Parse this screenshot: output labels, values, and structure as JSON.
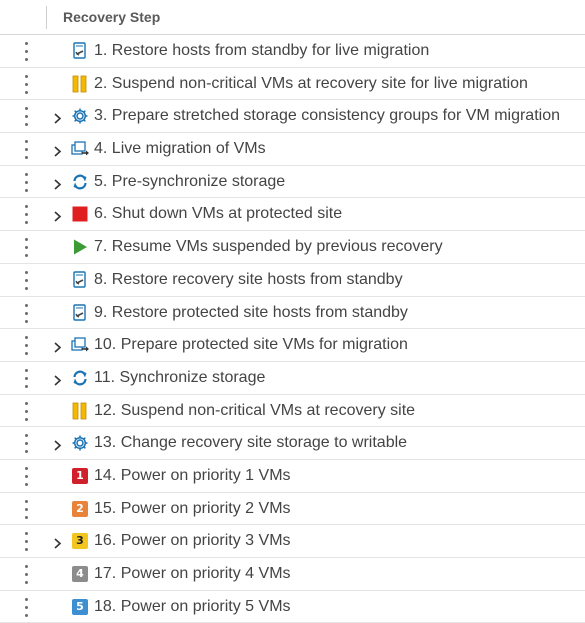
{
  "header": {
    "title": "Recovery Step"
  },
  "steps": [
    {
      "label": "1. Restore hosts from standby for live migration",
      "icon": "host-restore-icon",
      "expandable": false
    },
    {
      "label": "2. Suspend non-critical VMs at recovery site for live migration",
      "icon": "pause-icon",
      "expandable": false
    },
    {
      "label": "3. Prepare stretched storage consistency groups for VM migration",
      "icon": "gear-icon",
      "expandable": true
    },
    {
      "label": "4. Live migration of VMs",
      "icon": "vm-migrate-icon",
      "expandable": true
    },
    {
      "label": "5. Pre-synchronize storage",
      "icon": "sync-icon",
      "expandable": true
    },
    {
      "label": "6. Shut down VMs at protected site",
      "icon": "stop-icon",
      "expandable": true
    },
    {
      "label": "7. Resume VMs suspended by previous recovery",
      "icon": "play-icon",
      "expandable": false
    },
    {
      "label": "8. Restore recovery site hosts from standby",
      "icon": "host-restore-icon",
      "expandable": false
    },
    {
      "label": "9. Restore protected site hosts from standby",
      "icon": "host-restore-icon",
      "expandable": false
    },
    {
      "label": "10. Prepare protected site VMs for migration",
      "icon": "vm-migrate-icon",
      "expandable": true
    },
    {
      "label": "11. Synchronize storage",
      "icon": "sync-icon",
      "expandable": true
    },
    {
      "label": "12. Suspend non-critical VMs at recovery site",
      "icon": "pause-icon",
      "expandable": false
    },
    {
      "label": "13. Change recovery site storage to writable",
      "icon": "gear-icon",
      "expandable": true
    },
    {
      "label": "14. Power on priority 1 VMs",
      "icon": "priority-1-icon",
      "priority": "1",
      "expandable": false
    },
    {
      "label": "15. Power on priority 2 VMs",
      "icon": "priority-2-icon",
      "priority": "2",
      "expandable": false
    },
    {
      "label": "16. Power on priority 3 VMs",
      "icon": "priority-3-icon",
      "priority": "3",
      "expandable": true
    },
    {
      "label": "17. Power on priority 4 VMs",
      "icon": "priority-4-icon",
      "priority": "4",
      "expandable": false
    },
    {
      "label": "18. Power on priority 5 VMs",
      "icon": "priority-5-icon",
      "priority": "5",
      "expandable": false
    }
  ],
  "colors": {
    "priority_1": "#d0202c",
    "priority_2": "#e8833a",
    "priority_3": "#f3c61f",
    "priority_4": "#8c8c8c",
    "priority_5": "#3d8fd1",
    "pause": "#f5b800",
    "stop": "#e02020",
    "play": "#3c9b35",
    "accent_blue": "#1a73b5"
  }
}
